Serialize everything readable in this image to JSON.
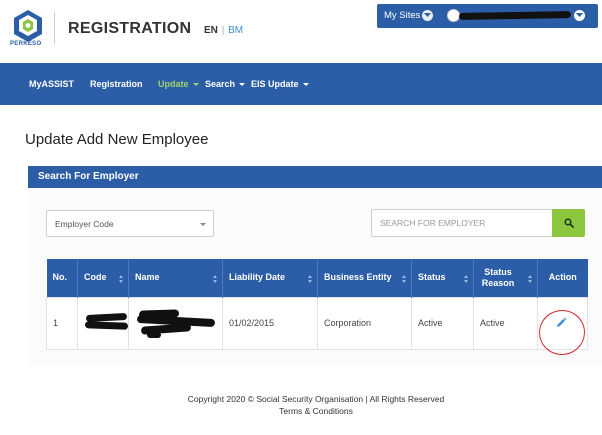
{
  "header": {
    "logo_text": "PERKESO",
    "title": "REGISTRATION",
    "lang_en": "EN",
    "lang_sep": "|",
    "lang_bm": "BM"
  },
  "topbar": {
    "my_sites": "My Sites"
  },
  "nav": {
    "items": [
      {
        "label": "MyASSIST",
        "active": false,
        "dropdown": false
      },
      {
        "label": "Registration",
        "active": false,
        "dropdown": false
      },
      {
        "label": "Update",
        "active": true,
        "dropdown": true
      },
      {
        "label": "Search",
        "active": false,
        "dropdown": true
      },
      {
        "label": "EIS Update",
        "active": false,
        "dropdown": true
      }
    ]
  },
  "page": {
    "title": "Update Add New Employee"
  },
  "search_panel": {
    "title": "Search For Employer",
    "select_value": "Employer Code",
    "search_placeholder": "SEARCH FOR EMPLOYER"
  },
  "table": {
    "columns": [
      "No.",
      "Code",
      "Name",
      "Liability Date",
      "Business Entity",
      "Status",
      "Status Reason",
      "Action"
    ],
    "rows": [
      {
        "no": "1",
        "code": "",
        "name": "",
        "liability_date": "01/02/2015",
        "business_entity": "Corporation",
        "status": "Active",
        "status_reason": "Active"
      }
    ]
  },
  "footer": {
    "copyright": "Copyright 2020 © Social Security Organisation | All Rights Reserved",
    "terms": "Terms & Conditions"
  },
  "colors": {
    "brand_blue": "#2b5ea7",
    "active_green": "#9fd36b",
    "search_green": "#8cc63f",
    "annotation_red": "#d9232e"
  }
}
